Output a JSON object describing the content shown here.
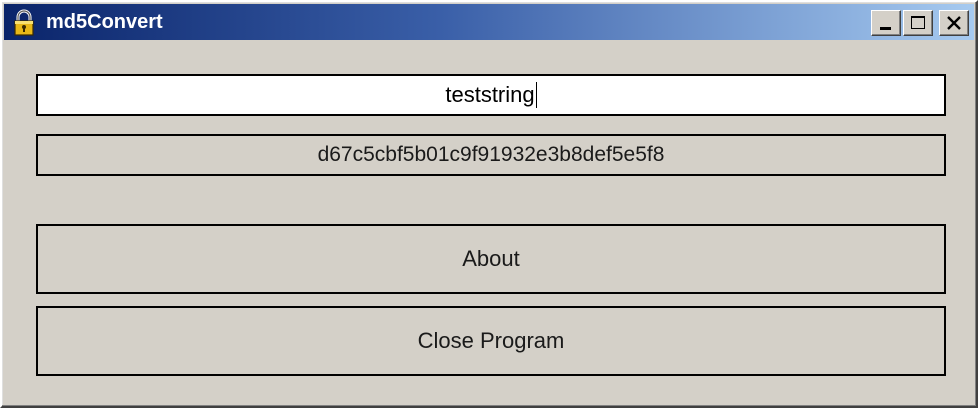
{
  "window": {
    "title": "md5Convert",
    "icon": "lock-icon",
    "title_buttons": [
      "minimize-icon",
      "maximize-icon",
      "close-icon"
    ],
    "colors": {
      "titlebar_start": "#0a246a",
      "titlebar_end": "#a6caf0",
      "face": "#d4d0c8"
    }
  },
  "input": {
    "value": "teststring"
  },
  "output": {
    "hash": "d67c5cbf5b01c9f91932e3b8def5e5f8"
  },
  "buttons": {
    "about_label": "About",
    "close_program_label": "Close Program"
  }
}
